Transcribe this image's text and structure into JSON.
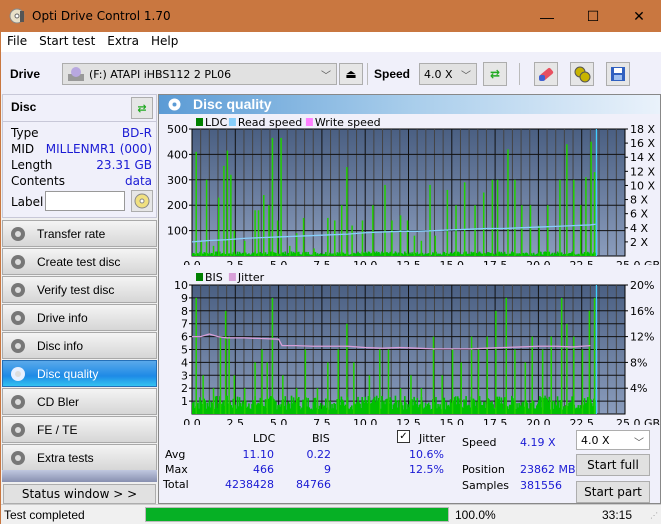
{
  "window": {
    "title": "Opti Drive Control 1.70",
    "minimize": "—",
    "maximize": "☐",
    "close": "✕"
  },
  "menu": [
    "File",
    "Start test",
    "Extra",
    "Help"
  ],
  "toolbar": {
    "drive_label": "Drive",
    "drive_value": "(F:)  ATAPI iHBS112  2 PL06",
    "speed_label": "Speed",
    "speed_value": "4.0 X"
  },
  "disc": {
    "header": "Disc",
    "rows": [
      {
        "k": "Type",
        "v": "BD-R"
      },
      {
        "k": "MID",
        "v": "MILLENMR1 (000)"
      },
      {
        "k": "Length",
        "v": "23.31 GB"
      },
      {
        "k": "Contents",
        "v": "data"
      }
    ],
    "label_key": "Label",
    "label_value": ""
  },
  "nav": [
    {
      "label": "Transfer rate",
      "active": false
    },
    {
      "label": "Create test disc",
      "active": false
    },
    {
      "label": "Verify test disc",
      "active": false
    },
    {
      "label": "Drive info",
      "active": false
    },
    {
      "label": "Disc info",
      "active": false
    },
    {
      "label": "Disc quality",
      "active": true
    },
    {
      "label": "CD Bler",
      "active": false
    },
    {
      "label": "FE / TE",
      "active": false
    },
    {
      "label": "Extra tests",
      "active": false
    }
  ],
  "status_window_btn": "Status window > >",
  "panel": {
    "title": "Disc quality"
  },
  "chart_data": [
    {
      "type": "bar",
      "title": "LDC / Read speed",
      "legend": [
        "LDC",
        "Read speed",
        "Write speed"
      ],
      "legend_colors": [
        "#008000",
        "#87cefa",
        "#ff80ff"
      ],
      "xlabel": "GB",
      "xlim": [
        0,
        25
      ],
      "ylim": [
        0,
        500
      ],
      "y2lim": [
        0,
        18
      ],
      "xticks": [
        "0.0",
        "2.5",
        "5.0",
        "7.5",
        "10.0",
        "12.5",
        "15.0",
        "17.5",
        "20.0",
        "22.5",
        "25.0 GB"
      ],
      "yticks": [
        "500",
        "400",
        "300",
        "200",
        "100"
      ],
      "y2ticks": [
        "18 X",
        "16 X",
        "14 X",
        "12 X",
        "10 X",
        "8 X",
        "6 X",
        "4 X",
        "2 X"
      ],
      "ldc_peaks": [
        [
          0.2,
          410
        ],
        [
          0.5,
          60
        ],
        [
          0.8,
          300
        ],
        [
          1.2,
          40
        ],
        [
          1.5,
          230
        ],
        [
          1.8,
          355
        ],
        [
          2.0,
          415
        ],
        [
          2.2,
          320
        ],
        [
          2.4,
          100
        ],
        [
          3.0,
          60
        ],
        [
          3.6,
          180
        ],
        [
          3.8,
          180
        ],
        [
          4.1,
          240
        ],
        [
          4.4,
          200
        ],
        [
          4.6,
          465
        ],
        [
          4.9,
          140
        ],
        [
          5.1,
          465
        ],
        [
          5.6,
          40
        ],
        [
          6.0,
          90
        ],
        [
          6.4,
          150
        ],
        [
          7.0,
          30
        ],
        [
          7.8,
          150
        ],
        [
          8.2,
          140
        ],
        [
          8.6,
          200
        ],
        [
          8.9,
          350
        ],
        [
          9.2,
          120
        ],
        [
          9.8,
          140
        ],
        [
          10.4,
          200
        ],
        [
          11.1,
          280
        ],
        [
          11.5,
          140
        ],
        [
          12.0,
          160
        ],
        [
          12.4,
          140
        ],
        [
          12.8,
          80
        ],
        [
          13.2,
          60
        ],
        [
          13.7,
          280
        ],
        [
          14.0,
          80
        ],
        [
          14.7,
          260
        ],
        [
          15.2,
          200
        ],
        [
          15.7,
          290
        ],
        [
          16.3,
          200
        ],
        [
          16.8,
          250
        ],
        [
          17.3,
          300
        ],
        [
          17.6,
          300
        ],
        [
          18.2,
          420
        ],
        [
          18.6,
          300
        ],
        [
          19.0,
          200
        ],
        [
          19.5,
          200
        ],
        [
          20.0,
          120
        ],
        [
          20.5,
          200
        ],
        [
          21.2,
          300
        ],
        [
          21.6,
          440
        ],
        [
          22.0,
          300
        ],
        [
          22.4,
          200
        ],
        [
          22.7,
          310
        ],
        [
          23.0,
          450
        ],
        [
          23.2,
          330
        ]
      ],
      "read_speed": [
        [
          0,
          2.0
        ],
        [
          0.5,
          2.1
        ],
        [
          1,
          2.2
        ],
        [
          2,
          2.3
        ],
        [
          3,
          2.5
        ],
        [
          4,
          2.6
        ],
        [
          5,
          2.7
        ],
        [
          6,
          2.8
        ],
        [
          7,
          2.9
        ],
        [
          8,
          3.0
        ],
        [
          9,
          3.1
        ],
        [
          10,
          3.3
        ],
        [
          11,
          3.4
        ],
        [
          12,
          3.5
        ],
        [
          13,
          3.5
        ],
        [
          14,
          3.6
        ],
        [
          15,
          3.7
        ],
        [
          16,
          3.8
        ],
        [
          17,
          3.9
        ],
        [
          18,
          3.9
        ],
        [
          19,
          4.0
        ],
        [
          20,
          4.1
        ],
        [
          21,
          4.2
        ],
        [
          22,
          4.3
        ],
        [
          23,
          4.4
        ],
        [
          23.3,
          4.5
        ]
      ]
    },
    {
      "type": "bar",
      "title": "BIS / Jitter",
      "legend": [
        "BIS",
        "Jitter"
      ],
      "legend_colors": [
        "#008000",
        "#d8a0d8"
      ],
      "xlabel": "GB",
      "xlim": [
        0,
        25
      ],
      "ylim": [
        0,
        10
      ],
      "y2lim": [
        0,
        20
      ],
      "xticks": [
        "0.0",
        "2.5",
        "5.0",
        "7.5",
        "10.0",
        "12.5",
        "15.0",
        "17.5",
        "20.0",
        "22.5",
        "25.0 GB"
      ],
      "yticks": [
        "10",
        "9",
        "8",
        "7",
        "6",
        "5",
        "4",
        "3",
        "2",
        "1"
      ],
      "y2ticks": [
        "20%",
        "16%",
        "12%",
        "8%",
        "4%"
      ],
      "bis_peaks": [
        [
          0.2,
          9
        ],
        [
          0.6,
          3
        ],
        [
          1.2,
          2
        ],
        [
          1.6,
          6
        ],
        [
          1.9,
          8
        ],
        [
          2.1,
          6
        ],
        [
          2.4,
          3
        ],
        [
          3.0,
          2
        ],
        [
          3.6,
          4
        ],
        [
          4.0,
          5
        ],
        [
          4.3,
          4
        ],
        [
          4.6,
          9
        ],
        [
          5.2,
          3
        ],
        [
          6.0,
          2
        ],
        [
          6.5,
          5
        ],
        [
          7.2,
          2
        ],
        [
          7.8,
          4
        ],
        [
          8.4,
          5
        ],
        [
          8.9,
          7
        ],
        [
          9.3,
          4
        ],
        [
          10.2,
          3
        ],
        [
          10.8,
          5
        ],
        [
          11.3,
          5
        ],
        [
          12.0,
          2
        ],
        [
          12.6,
          3
        ],
        [
          13.2,
          2
        ],
        [
          13.9,
          6
        ],
        [
          14.4,
          3
        ],
        [
          15.0,
          5
        ],
        [
          15.5,
          4
        ],
        [
          16.1,
          6
        ],
        [
          16.5,
          5
        ],
        [
          17.0,
          6
        ],
        [
          17.5,
          8
        ],
        [
          18.1,
          9
        ],
        [
          18.6,
          5
        ],
        [
          19.2,
          4
        ],
        [
          19.6,
          6
        ],
        [
          20.2,
          5
        ],
        [
          20.7,
          6
        ],
        [
          21.3,
          9
        ],
        [
          21.6,
          7
        ],
        [
          22.0,
          6
        ],
        [
          22.5,
          5
        ],
        [
          22.9,
          8
        ],
        [
          23.2,
          9
        ]
      ],
      "jitter": [
        [
          0,
          12.0
        ],
        [
          0.5,
          12.0
        ],
        [
          1,
          12.4
        ],
        [
          1.5,
          12.0
        ],
        [
          2,
          11.8
        ],
        [
          3,
          11.8
        ],
        [
          4,
          11.7
        ],
        [
          5,
          11.6
        ],
        [
          5.2,
          10.6
        ],
        [
          6,
          10.6
        ],
        [
          7,
          10.5
        ],
        [
          8,
          10.5
        ],
        [
          9,
          10.5
        ],
        [
          10,
          10.3
        ],
        [
          11,
          10.2
        ],
        [
          12,
          10.3
        ],
        [
          13,
          10.2
        ],
        [
          14,
          10.1
        ],
        [
          15,
          10.1
        ],
        [
          16,
          10.1
        ],
        [
          17,
          10.2
        ],
        [
          18,
          10.3
        ],
        [
          19,
          10.4
        ],
        [
          20,
          10.5
        ],
        [
          21,
          10.5
        ],
        [
          22,
          10.4
        ],
        [
          23,
          10.6
        ]
      ]
    }
  ],
  "stats": {
    "col_ldc": "LDC",
    "col_bis": "BIS",
    "jitter_label": "Jitter",
    "jitter_checked": true,
    "rows": [
      {
        "k": "Avg",
        "ldc": "11.10",
        "bis": "0.22",
        "jitter": "10.6%"
      },
      {
        "k": "Max",
        "ldc": "466",
        "bis": "9",
        "jitter": "12.5%"
      },
      {
        "k": "Total",
        "ldc": "4238428",
        "bis": "84766",
        "jitter": ""
      }
    ],
    "speed_label": "Speed",
    "speed_value": "4.19 X",
    "position_label": "Position",
    "position_value": "23862 MB",
    "samples_label": "Samples",
    "samples_value": "381556",
    "speed_select": "4.0 X",
    "start_full": "Start full",
    "start_part": "Start part"
  },
  "status": {
    "text": "Test completed",
    "progress": 100.0,
    "progress_text": "100.0%",
    "time": "33:15"
  }
}
